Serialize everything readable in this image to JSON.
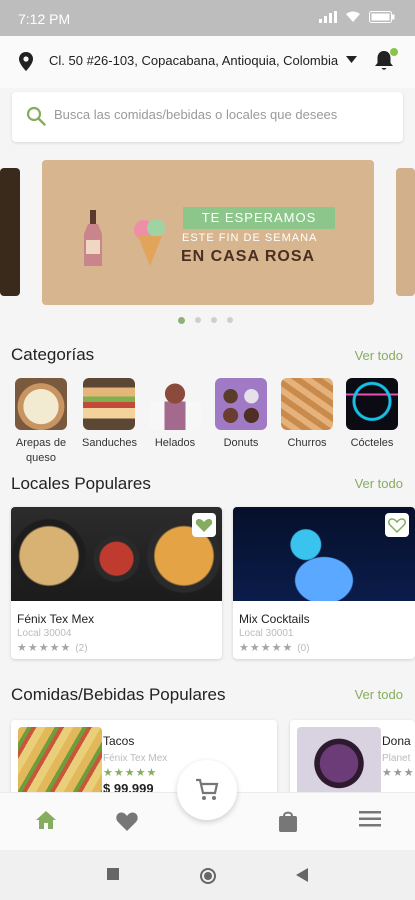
{
  "status_bar": {
    "time": "7:12 PM"
  },
  "location": {
    "address": "Cl. 50 #26-103, Copacabana, Antioquia, Colombia"
  },
  "search": {
    "placeholder": "Busca las comidas/bebidas o locales que desees"
  },
  "banner": {
    "tag": "TE ESPERAMOS",
    "line2": "ESTE FIN DE SEMANA",
    "line3": "EN CASA ROSA",
    "active_index": 0,
    "count": 4
  },
  "categories": {
    "title": "Categorías",
    "see_all": "Ver todo",
    "items": [
      {
        "label": "Arepas de queso",
        "icon": "arepa-image"
      },
      {
        "label": "Sanduches",
        "icon": "sandwich-image"
      },
      {
        "label": "Helados",
        "icon": "ice-cream-image"
      },
      {
        "label": "Donuts",
        "icon": "donut-image"
      },
      {
        "label": "Churros",
        "icon": "churro-image"
      },
      {
        "label": "Cócteles",
        "icon": "cocktail-image"
      }
    ]
  },
  "locales": {
    "title": "Locales Populares",
    "see_all": "Ver todo",
    "items": [
      {
        "name": "Fénix Tex Mex",
        "code": "Local 30004",
        "rating": 5,
        "reviews": "(2)",
        "favorite": true
      },
      {
        "name": "Mix Cocktails",
        "code": "Local 30001",
        "rating": 5,
        "reviews": "(0)",
        "favorite": false
      }
    ]
  },
  "foods": {
    "title": "Comidas/Bebidas Populares",
    "see_all": "Ver todo",
    "items": [
      {
        "name": "Tacos",
        "vendor": "Fénix Tex Mex",
        "rating": 5,
        "price": "$ 99.999"
      },
      {
        "name": "Dona",
        "vendor": "Planet",
        "rating": 3
      }
    ]
  },
  "colors": {
    "accent": "#86ad5f",
    "statusbar": "#bdbdbd",
    "banner_bg": "#d7b58f",
    "banner_tag": "#8cc68a"
  }
}
